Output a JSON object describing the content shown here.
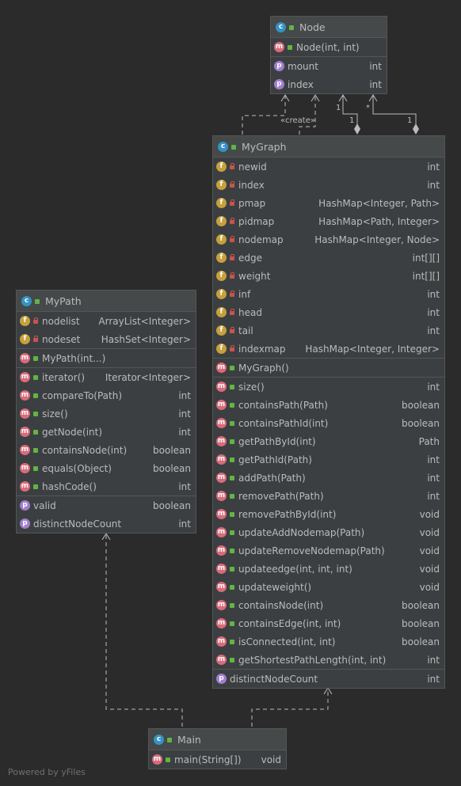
{
  "classes": {
    "node": {
      "name": "Node",
      "sections": [
        [
          {
            "icon": "m",
            "vis": "pub",
            "name": "Node(int, int)",
            "type": ""
          }
        ],
        [
          {
            "icon": "p",
            "vis": "none",
            "name": "mount",
            "type": "int"
          },
          {
            "icon": "p",
            "vis": "none",
            "name": "index",
            "type": "int"
          }
        ]
      ]
    },
    "mygraph": {
      "name": "MyGraph",
      "sections": [
        [
          {
            "icon": "f",
            "vis": "priv",
            "name": "newid",
            "type": "int"
          },
          {
            "icon": "f",
            "vis": "priv",
            "name": "index",
            "type": "int"
          },
          {
            "icon": "f",
            "vis": "priv",
            "name": "pmap",
            "type": "HashMap<Integer, Path>"
          },
          {
            "icon": "f",
            "vis": "priv",
            "name": "pidmap",
            "type": "HashMap<Path, Integer>"
          },
          {
            "icon": "f",
            "vis": "priv",
            "name": "nodemap",
            "type": "HashMap<Integer, Node>"
          },
          {
            "icon": "f",
            "vis": "priv",
            "name": "edge",
            "type": "int[][]"
          },
          {
            "icon": "f",
            "vis": "priv",
            "name": "weight",
            "type": "int[][]"
          },
          {
            "icon": "f",
            "vis": "priv",
            "name": "inf",
            "type": "int"
          },
          {
            "icon": "f",
            "vis": "priv",
            "name": "head",
            "type": "int"
          },
          {
            "icon": "f",
            "vis": "priv",
            "name": "tail",
            "type": "int"
          },
          {
            "icon": "f",
            "vis": "priv",
            "name": "indexmap",
            "type": "HashMap<Integer, Integer>"
          }
        ],
        [
          {
            "icon": "m",
            "vis": "pub",
            "name": "MyGraph()",
            "type": ""
          }
        ],
        [
          {
            "icon": "m",
            "vis": "pub",
            "name": "size()",
            "type": "int"
          },
          {
            "icon": "m",
            "vis": "pub",
            "name": "containsPath(Path)",
            "type": "boolean"
          },
          {
            "icon": "m",
            "vis": "pub",
            "name": "containsPathId(int)",
            "type": "boolean"
          },
          {
            "icon": "m",
            "vis": "pub",
            "name": "getPathById(int)",
            "type": "Path"
          },
          {
            "icon": "m",
            "vis": "pub",
            "name": "getPathId(Path)",
            "type": "int"
          },
          {
            "icon": "m",
            "vis": "pub",
            "name": "addPath(Path)",
            "type": "int"
          },
          {
            "icon": "m",
            "vis": "pub",
            "name": "removePath(Path)",
            "type": "int"
          },
          {
            "icon": "m",
            "vis": "pub",
            "name": "removePathById(int)",
            "type": "void"
          },
          {
            "icon": "m",
            "vis": "pub",
            "name": "updateAddNodemap(Path)",
            "type": "void"
          },
          {
            "icon": "m",
            "vis": "pub",
            "name": "updateRemoveNodemap(Path)",
            "type": "void"
          },
          {
            "icon": "m",
            "vis": "pub",
            "name": "updateedge(int, int, int)",
            "type": "void"
          },
          {
            "icon": "m",
            "vis": "pub",
            "name": "updateweight()",
            "type": "void"
          },
          {
            "icon": "m",
            "vis": "pub",
            "name": "containsNode(int)",
            "type": "boolean"
          },
          {
            "icon": "m",
            "vis": "pub",
            "name": "containsEdge(int, int)",
            "type": "boolean"
          },
          {
            "icon": "m",
            "vis": "pub",
            "name": "isConnected(int, int)",
            "type": "boolean"
          },
          {
            "icon": "m",
            "vis": "pub",
            "name": "getShortestPathLength(int, int)",
            "type": "int"
          }
        ],
        [
          {
            "icon": "p",
            "vis": "none",
            "name": "distinctNodeCount",
            "type": "int"
          }
        ]
      ]
    },
    "mypath": {
      "name": "MyPath",
      "sections": [
        [
          {
            "icon": "f",
            "vis": "priv",
            "name": "nodelist",
            "type": "ArrayList<Integer>"
          },
          {
            "icon": "f",
            "vis": "priv",
            "name": "nodeset",
            "type": "HashSet<Integer>"
          }
        ],
        [
          {
            "icon": "m",
            "vis": "pub",
            "name": "MyPath(int...)",
            "type": ""
          }
        ],
        [
          {
            "icon": "m",
            "vis": "pub",
            "name": "iterator()",
            "type": "Iterator<Integer>"
          },
          {
            "icon": "m",
            "vis": "pub",
            "name": "compareTo(Path)",
            "type": "int"
          },
          {
            "icon": "m",
            "vis": "pub",
            "name": "size()",
            "type": "int"
          },
          {
            "icon": "m",
            "vis": "pub",
            "name": "getNode(int)",
            "type": "int"
          },
          {
            "icon": "m",
            "vis": "pub",
            "name": "containsNode(int)",
            "type": "boolean"
          },
          {
            "icon": "m",
            "vis": "pub",
            "name": "equals(Object)",
            "type": "boolean"
          },
          {
            "icon": "m",
            "vis": "pub",
            "name": "hashCode()",
            "type": "int"
          }
        ],
        [
          {
            "icon": "p",
            "vis": "none",
            "name": "valid",
            "type": "boolean"
          },
          {
            "icon": "p",
            "vis": "none",
            "name": "distinctNodeCount",
            "type": "int"
          }
        ]
      ]
    },
    "main": {
      "name": "Main",
      "sections": [
        [
          {
            "icon": "m",
            "vis": "pub",
            "name": "main(String[])",
            "type": "void"
          }
        ]
      ]
    }
  },
  "labels": {
    "create": "«create»",
    "mult_1a": "1",
    "mult_1b": "1",
    "mult_star": "*",
    "mult_1c": "1"
  },
  "footer": "Powered by yFiles",
  "colors": {
    "background": "#2b2b2b",
    "box": "#3c3f41",
    "header": "#45494a",
    "border": "#555555",
    "line": "#bbbbbb"
  }
}
